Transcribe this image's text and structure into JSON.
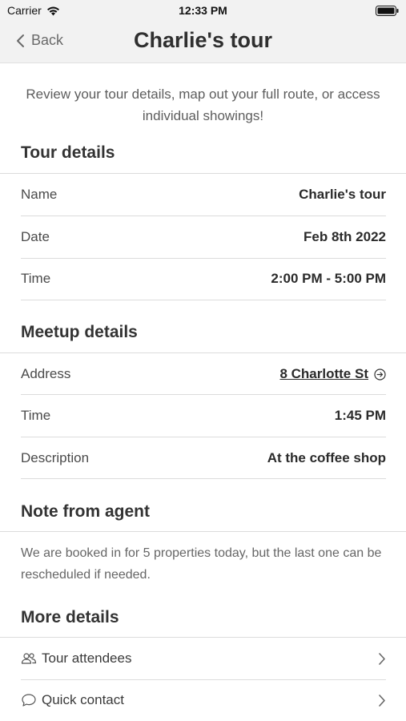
{
  "status": {
    "carrier": "Carrier",
    "time": "12:33 PM"
  },
  "nav": {
    "back_label": "Back",
    "title": "Charlie's tour"
  },
  "intro": "Review your tour details, map out your full route, or access individual showings!",
  "tour_details": {
    "title": "Tour details",
    "rows": [
      {
        "label": "Name",
        "value": "Charlie's tour"
      },
      {
        "label": "Date",
        "value": "Feb 8th 2022"
      },
      {
        "label": "Time",
        "value": "2:00 PM - 5:00 PM"
      }
    ]
  },
  "meetup_details": {
    "title": "Meetup details",
    "rows": [
      {
        "label": "Address",
        "value": "8 Charlotte St"
      },
      {
        "label": "Time",
        "value": "1:45 PM"
      },
      {
        "label": "Description",
        "value": "At the coffee shop"
      }
    ]
  },
  "note": {
    "title": "Note from agent",
    "text": "We are booked in for 5 properties today, but the last one can be rescheduled if needed."
  },
  "more_details": {
    "title": "More details",
    "items": [
      {
        "label": "Tour attendees",
        "icon": "people-icon"
      },
      {
        "label": "Quick contact",
        "icon": "chat-bubble-icon"
      }
    ]
  }
}
